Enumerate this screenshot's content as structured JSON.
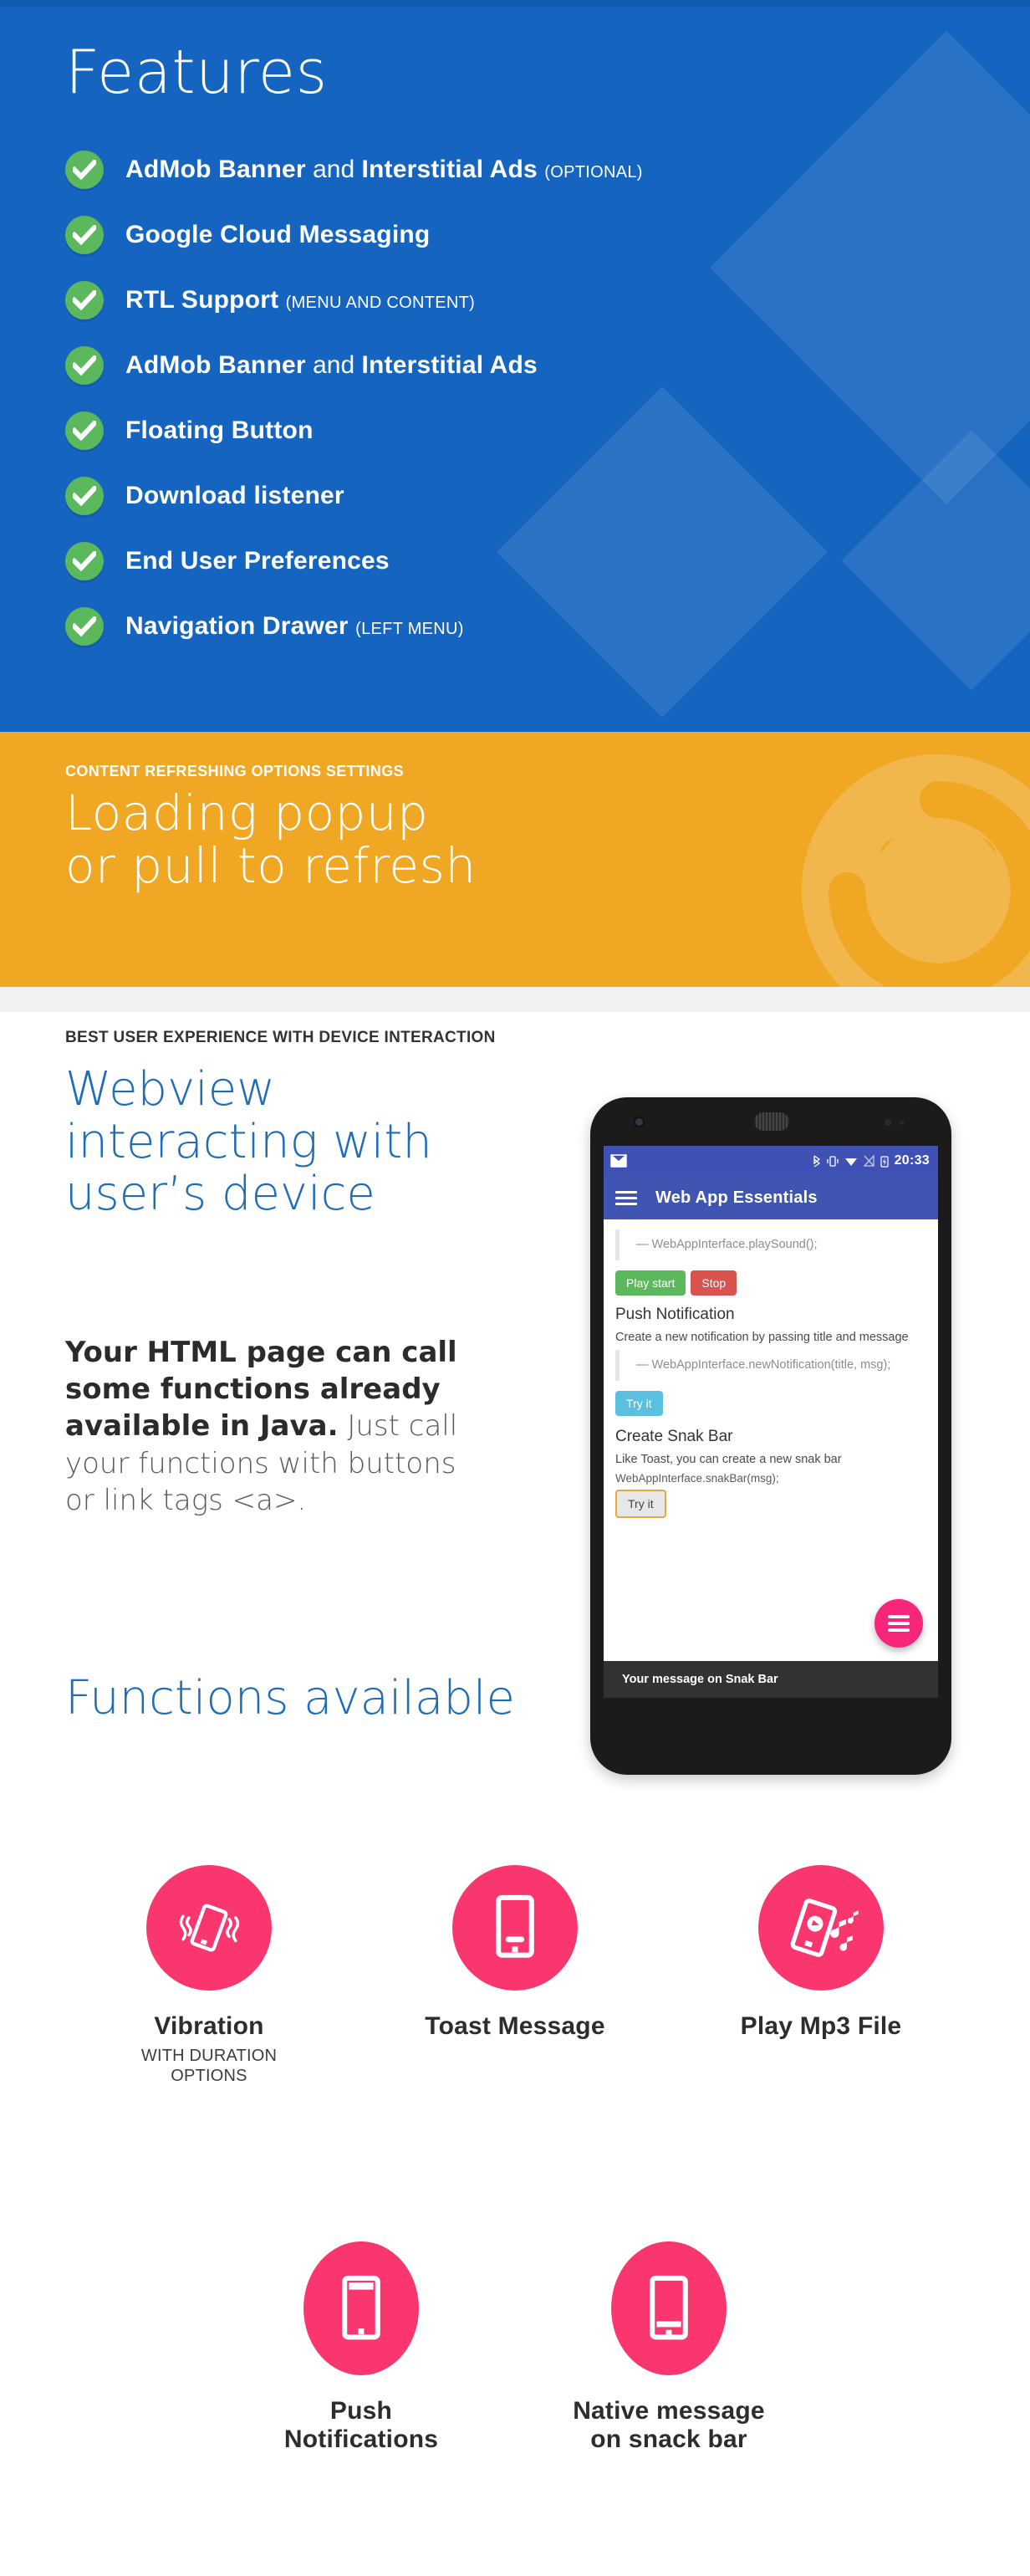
{
  "colors": {
    "blue_bg": "#1565c0",
    "orange_bg": "#efa724",
    "heading_blue": "#1f6cb8",
    "pink": "#f9376e",
    "check_green": "#5cb85c",
    "android_bar": "#3f51b5",
    "snackbar": "#323232"
  },
  "features": {
    "title": "Features",
    "items": [
      {
        "bold": "AdMob Banner",
        "normal": " and ",
        "bold2": "Interstitial Ads",
        "paren": "(OPTIONAL)"
      },
      {
        "bold": "Google Cloud Messaging",
        "normal": "",
        "bold2": "",
        "paren": ""
      },
      {
        "bold": "RTL Support",
        "normal": "",
        "bold2": "",
        "paren": "(MENU AND CONTENT)"
      },
      {
        "bold": "AdMob Banner",
        "normal": " and ",
        "bold2": "Interstitial Ads",
        "paren": ""
      },
      {
        "bold": "Floating Button",
        "normal": "",
        "bold2": "",
        "paren": ""
      },
      {
        "bold": "Download listener",
        "normal": "",
        "bold2": "",
        "paren": ""
      },
      {
        "bold": "End User Preferences",
        "normal": "",
        "bold2": "",
        "paren": ""
      },
      {
        "bold": "Navigation Drawer",
        "normal": "",
        "bold2": "",
        "paren": "(LEFT MENU)"
      }
    ]
  },
  "refresh": {
    "kicker": "CONTENT REFRESHING OPTIONS SETTINGS",
    "line1": "Loading popup",
    "line2": "or pull to refresh"
  },
  "webview": {
    "kicker": "BEST USER EXPERIENCE WITH DEVICE  INTERACTION",
    "heading": "Webview interacting with user’s device",
    "body_bold": "Your HTML page can call some functions already available in Java.",
    "body_rest": " Just call your functions with buttons or link tags <a>.",
    "functions_heading": "Functions available"
  },
  "phone": {
    "status": {
      "clock": "20:33",
      "icons": [
        "bluetooth-icon",
        "vibrate-icon",
        "wifi-icon",
        "signal-off-icon",
        "battery-charging-icon"
      ]
    },
    "appbar": {
      "title": "Web App Essentials",
      "menu_icon": "hamburger-icon"
    },
    "content": {
      "code1": "— WebAppInterface.playSound();",
      "btn_play": "Play start",
      "btn_stop": "Stop",
      "section2_title": "Push Notification",
      "section2_desc": "Create a new notification by passing title and message",
      "code2": "— WebAppInterface.newNotification(title, msg);",
      "btn_try1": "Try it",
      "section3_title": "Create Snak Bar",
      "section3_desc": "Like Toast, you can create a new snak bar",
      "code3": "WebAppInterface.snakBar(msg);",
      "btn_try2": "Try it",
      "snackbar_text": "Your message on Snak Bar",
      "fab_icon": "menu-fab-icon"
    },
    "navbar": {
      "back": "back-icon",
      "home": "home-icon",
      "recents": "recents-icon"
    }
  },
  "function_icons": {
    "row1": [
      {
        "icon": "vibrating-phone-icon",
        "label": "Vibration",
        "sub": "WITH DURATION OPTIONS",
        "shape": "circle"
      },
      {
        "icon": "toast-message-phone-icon",
        "label": "Toast Message",
        "sub": "",
        "shape": "circle"
      },
      {
        "icon": "play-mp3-phone-icon",
        "label": "Play Mp3 File",
        "sub": "",
        "shape": "circle"
      }
    ],
    "row2": [
      {
        "icon": "push-notification-phone-icon",
        "label": "Push Notifications",
        "sub": "",
        "shape": "oval"
      },
      {
        "icon": "snackbar-phone-icon",
        "label": "Native message on snack bar",
        "sub": "",
        "shape": "oval"
      }
    ]
  }
}
